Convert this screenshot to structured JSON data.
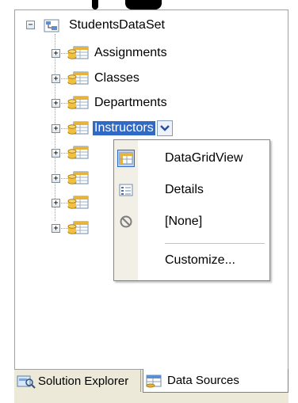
{
  "tree": {
    "root": {
      "label": "StudentsDataSet",
      "expander": "−",
      "icon": "dataset-icon"
    },
    "children": [
      {
        "label": "Assignments",
        "expander": "+"
      },
      {
        "label": "Classes",
        "expander": "+"
      },
      {
        "label": "Departments",
        "expander": "+"
      },
      {
        "label": "Instructors",
        "expander": "+",
        "selected": true
      },
      {
        "label": "",
        "expander": "+"
      },
      {
        "label": "",
        "expander": "+"
      },
      {
        "label": "",
        "expander": "+"
      },
      {
        "label": "",
        "expander": "+"
      }
    ]
  },
  "context_menu": {
    "items": [
      {
        "label": "DataGridView",
        "icon": "datagridview-icon",
        "checked": true
      },
      {
        "label": "Details",
        "icon": "details-icon",
        "checked": false
      },
      {
        "label": "[None]",
        "icon": "none-icon",
        "checked": false
      },
      {
        "label": "Customize...",
        "icon": "",
        "checked": false
      }
    ]
  },
  "tabs": {
    "solution_explorer": "Solution Explorer",
    "data_sources": "Data Sources"
  },
  "colors": {
    "selection": "#316ac5",
    "menu_gutter": "#f1efe6",
    "tabbar": "#ece9d8"
  }
}
